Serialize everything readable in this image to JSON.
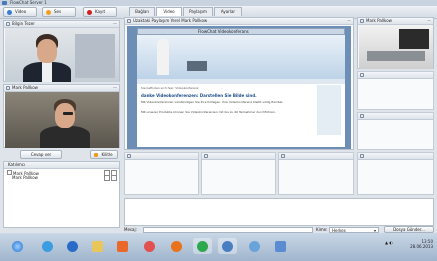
{
  "window": {
    "title": "FlowChat Server 1"
  },
  "toolbar": {
    "buttons": [
      {
        "label": "Video",
        "color": "#3a7bd5"
      },
      {
        "label": "Ses",
        "color": "#f0a020"
      },
      {
        "label": "Kayıt",
        "color": "#d02020"
      }
    ]
  },
  "tabs": [
    {
      "label": "Bağlan",
      "active": false
    },
    {
      "label": "Video",
      "active": true
    },
    {
      "label": "Paylaşım",
      "active": false
    },
    {
      "label": "Ayarlar",
      "active": false
    }
  ],
  "left": {
    "video1_label": "Bilgin Tezer",
    "video2_label": "Mark Pallkow",
    "answer_button": "Cevap ver",
    "mute_button": "Kilitle",
    "participants_header": "Katılımcı",
    "participants": [
      "Mark Pallkow",
      "Mark Pallkow"
    ]
  },
  "share": {
    "header": "Uzaktaki Paylaşım Yerel Mark Pallkow",
    "browser_title": "FlowChat Videokonferans",
    "page_nav": "Sie befinden sich hier: Videokonferenz",
    "heading": "danke Videokonferenzen: Darstellen Sie Bilde sind.",
    "para1": "Mit Videokonferenzen verständigen Sie Ihre Kollegen. Ihre Videokonferenz bleibt völlig flexibel.",
    "para2": "Mit unserer Produkte können Sie Videokonferenzen mit bis zu 40 Teilnehmer durchführen."
  },
  "right": {
    "video_label": "Mark Pallkow"
  },
  "chat": {
    "label": "Mesaj:",
    "send_label": "Gönder",
    "sender_label": "Kime:",
    "sender_value": "Herkes",
    "upload_button": "Dosya Gönder..."
  },
  "system": {
    "time": "13:50",
    "date": "28.06.2013"
  },
  "taskbar": {
    "items": [
      {
        "name": "windows-start-icon",
        "color": "#3a8ee6"
      },
      {
        "name": "ie-icon",
        "color": "#3b9de0"
      },
      {
        "name": "media-icon",
        "color": "#2a6bc8"
      },
      {
        "name": "explorer-icon",
        "color": "#e8c65a"
      },
      {
        "name": "video-app-icon",
        "color": "#e9682a"
      },
      {
        "name": "paint-icon",
        "color": "#e25050"
      },
      {
        "name": "firefox-icon",
        "color": "#e8731a"
      },
      {
        "name": "chrome-icon",
        "color": "#2da84d"
      },
      {
        "name": "network-icon",
        "color": "#4a7ec2"
      },
      {
        "name": "globe-icon",
        "color": "#6aa3d8"
      },
      {
        "name": "people-icon",
        "color": "#5b8bd0"
      }
    ]
  }
}
